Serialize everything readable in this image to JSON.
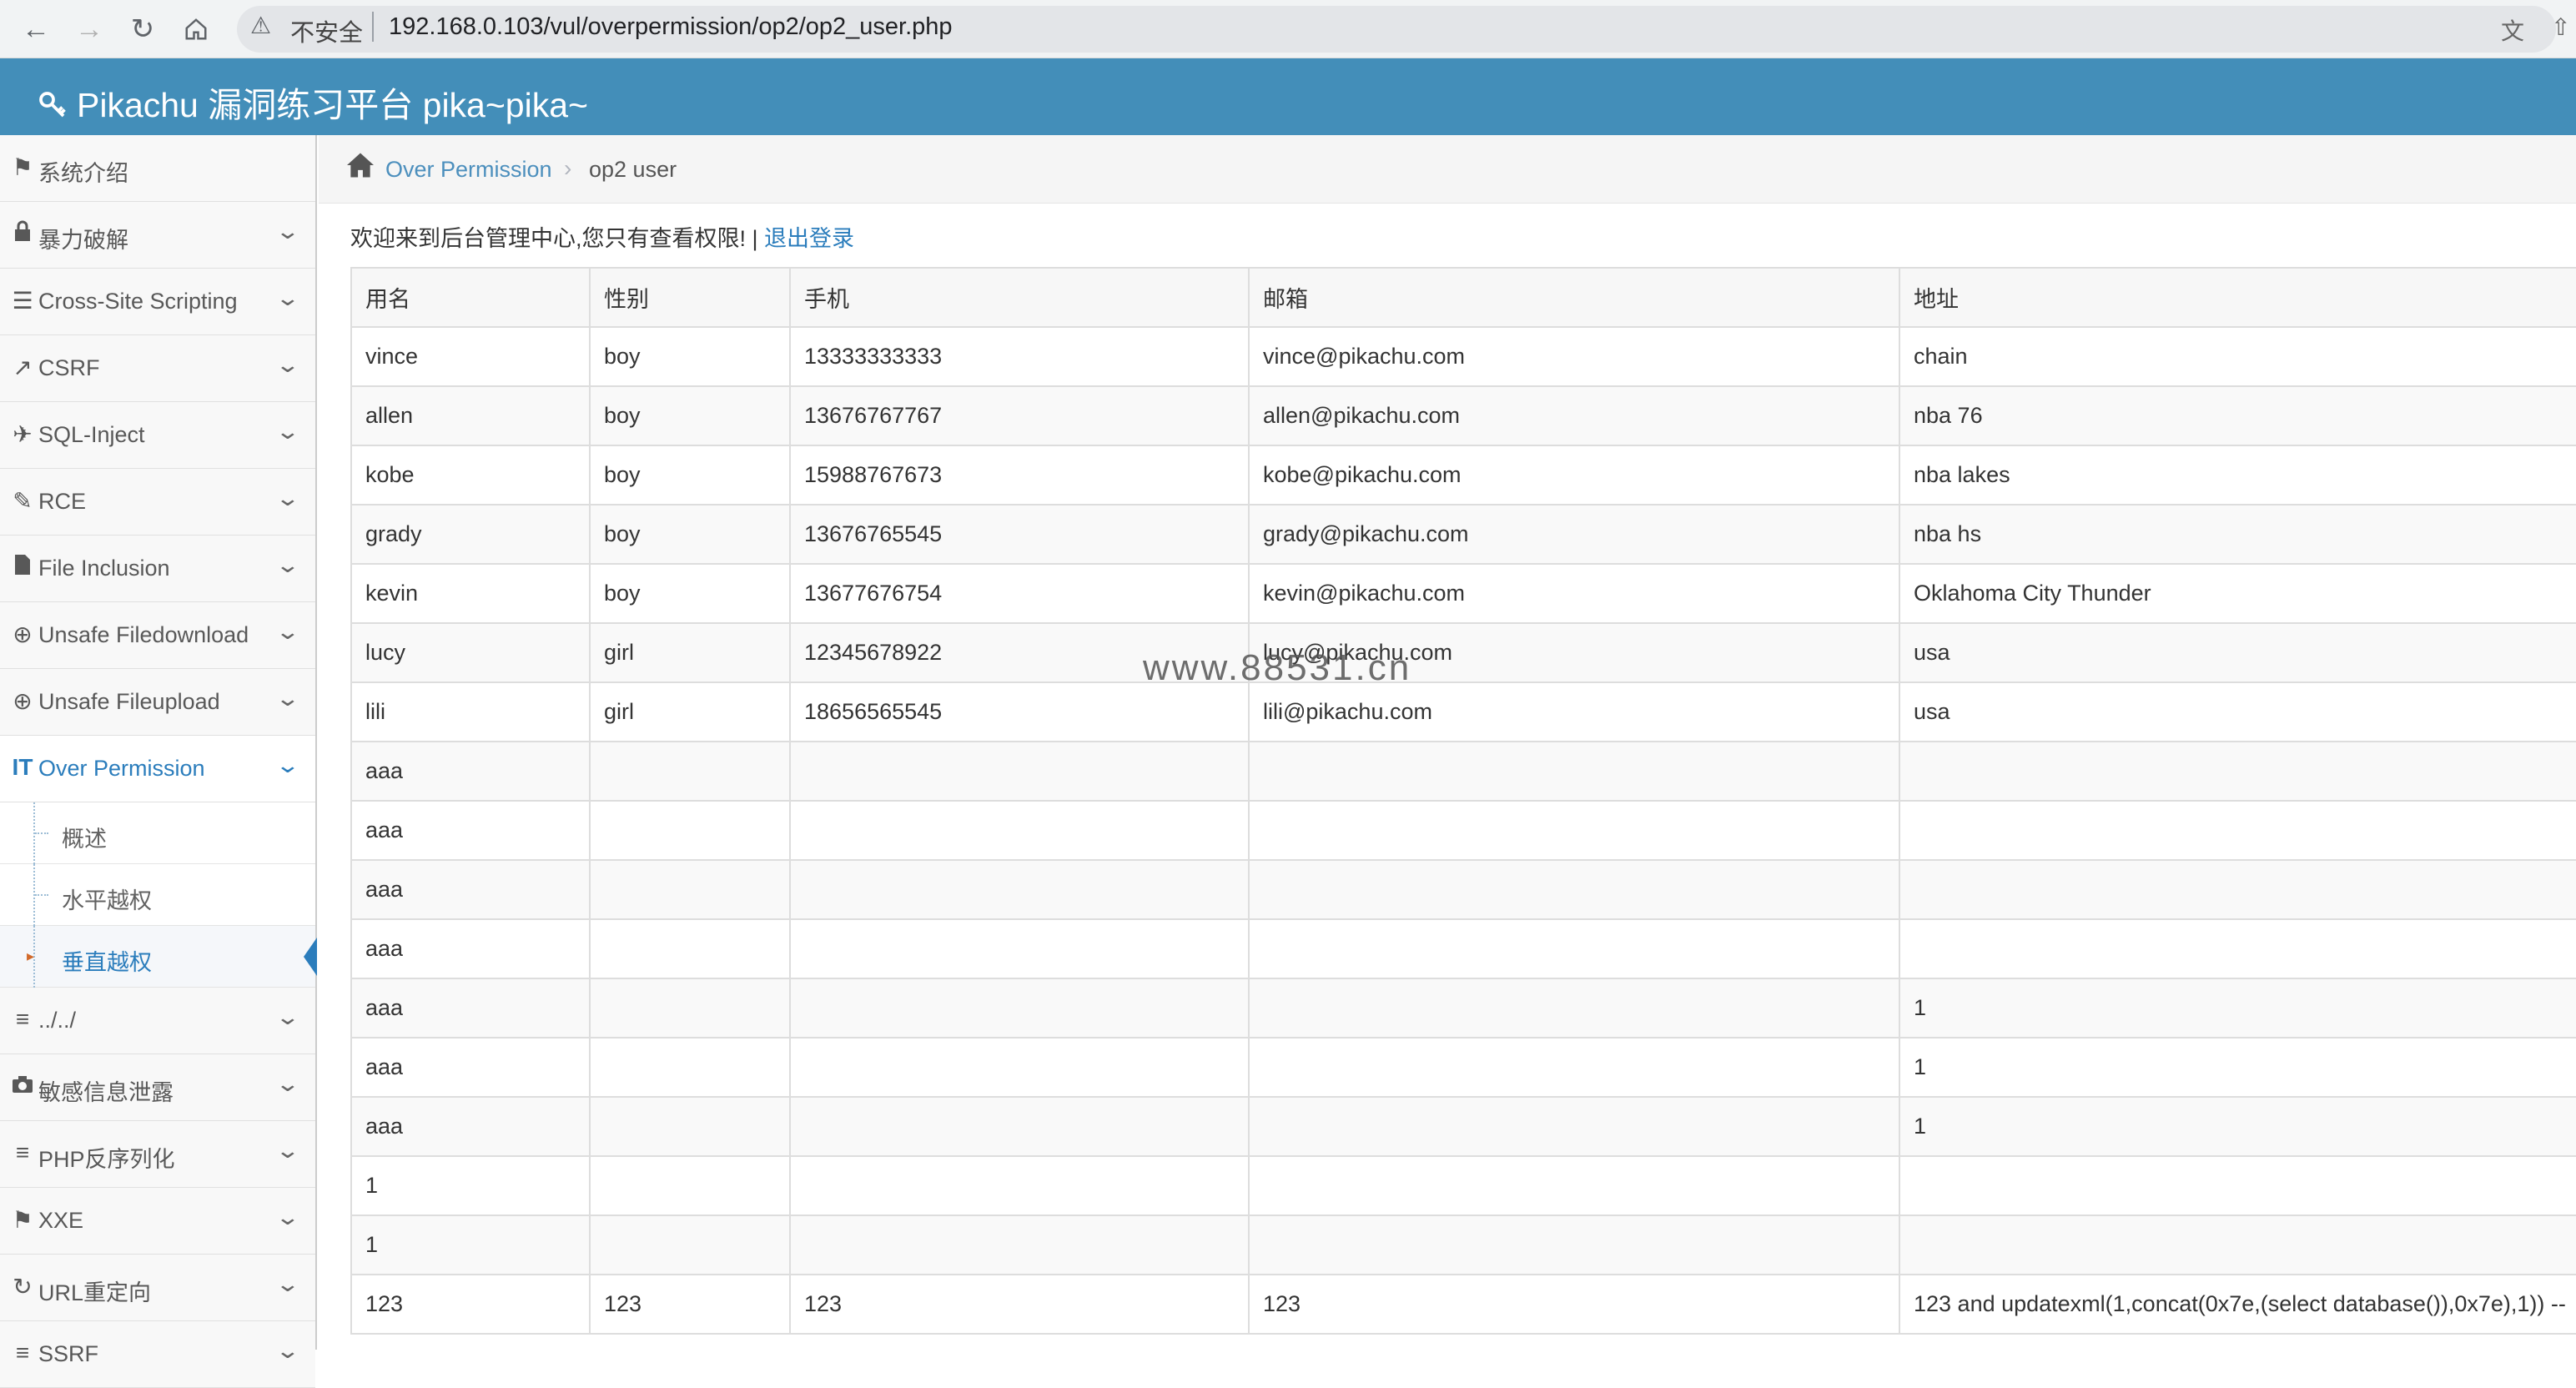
{
  "browser": {
    "insecure_label": "不安全",
    "url": "192.168.0.103/vul/overpermission/op2/op2_user.php"
  },
  "header": {
    "title": "Pikachu 漏洞练习平台 pika~pika~"
  },
  "sidebar": {
    "items": [
      {
        "label": "系统介绍"
      },
      {
        "label": "暴力破解"
      },
      {
        "label": "Cross-Site Scripting"
      },
      {
        "label": "CSRF"
      },
      {
        "label": "SQL-Inject"
      },
      {
        "label": "RCE"
      },
      {
        "label": "File Inclusion"
      },
      {
        "label": "Unsafe Filedownload"
      },
      {
        "label": "Unsafe Fileupload"
      },
      {
        "label": "Over Permission"
      },
      {
        "label": "../../"
      },
      {
        "label": "敏感信息泄露"
      },
      {
        "label": "PHP反序列化"
      },
      {
        "label": "XXE"
      },
      {
        "label": "URL重定向"
      },
      {
        "label": "SSRF"
      }
    ],
    "sub_items": [
      {
        "label": "概述"
      },
      {
        "label": "水平越权"
      },
      {
        "label": "垂直越权"
      }
    ]
  },
  "breadcrumb": {
    "section": "Over Permission",
    "current": "op2 user"
  },
  "welcome": {
    "text": "欢迎来到后台管理中心,您只有查看权限! | ",
    "logout": "退出登录"
  },
  "table": {
    "headers": [
      "用名",
      "性别",
      "手机",
      "邮箱",
      "地址"
    ],
    "rows": [
      [
        "vince",
        "boy",
        "13333333333",
        "vince@pikachu.com",
        "chain"
      ],
      [
        "allen",
        "boy",
        "13676767767",
        "allen@pikachu.com",
        "nba 76"
      ],
      [
        "kobe",
        "boy",
        "15988767673",
        "kobe@pikachu.com",
        "nba lakes"
      ],
      [
        "grady",
        "boy",
        "13676765545",
        "grady@pikachu.com",
        "nba hs"
      ],
      [
        "kevin",
        "boy",
        "13677676754",
        "kevin@pikachu.com",
        "Oklahoma City Thunder"
      ],
      [
        "lucy",
        "girl",
        "12345678922",
        "lucy@pikachu.com",
        "usa"
      ],
      [
        "lili",
        "girl",
        "18656565545",
        "lili@pikachu.com",
        "usa"
      ],
      [
        "aaa",
        "",
        "",
        "",
        ""
      ],
      [
        "aaa",
        "",
        "",
        "",
        ""
      ],
      [
        "aaa",
        "",
        "",
        "",
        ""
      ],
      [
        "aaa",
        "",
        "",
        "",
        ""
      ],
      [
        "aaa",
        "",
        "",
        "",
        "1"
      ],
      [
        "aaa",
        "",
        "",
        "",
        "1"
      ],
      [
        "aaa",
        "",
        "",
        "",
        "1"
      ],
      [
        "1",
        "",
        "",
        "",
        ""
      ],
      [
        "1",
        "",
        "",
        "",
        ""
      ],
      [
        "123",
        "123",
        "123",
        "123",
        "123 and updatexml(1,concat(0x7e,(select database()),0x7e),1)) --"
      ]
    ]
  },
  "watermark": "www.88531.cn",
  "colors": {
    "header_bg": "#438eb9",
    "link": "#2b7dbc"
  }
}
